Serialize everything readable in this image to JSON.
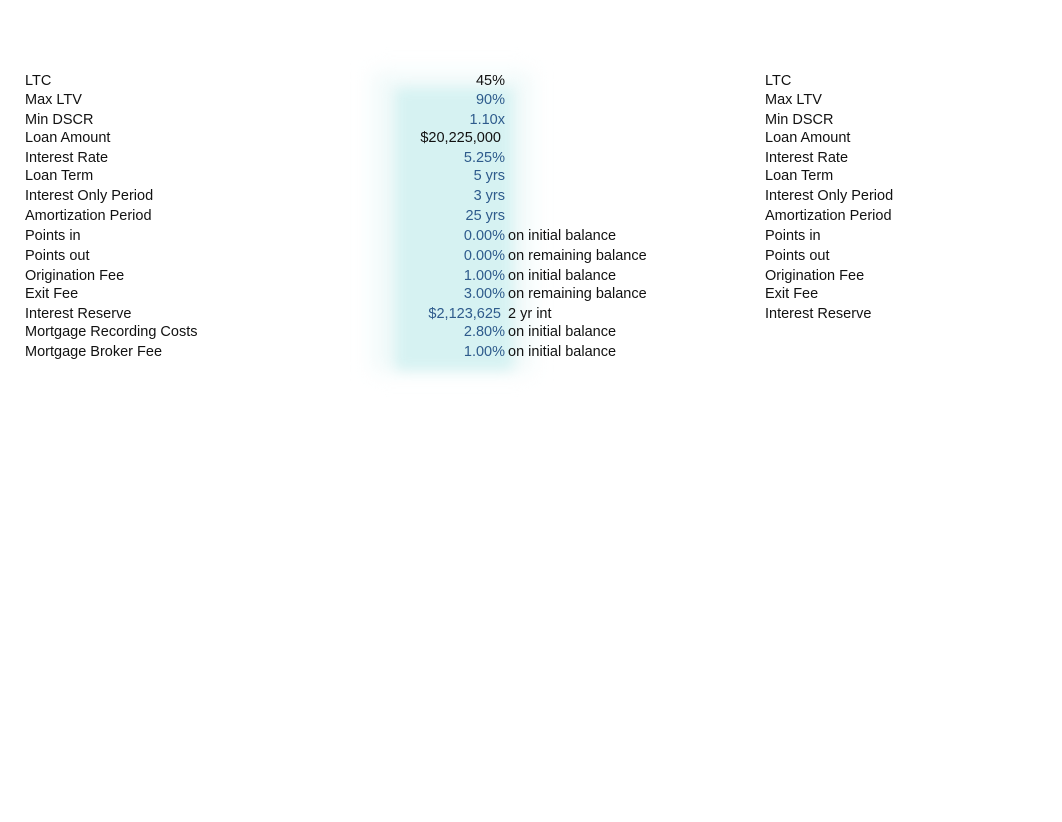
{
  "left_table": {
    "rows": [
      {
        "label": "LTC",
        "value": "45%",
        "value_style": "black",
        "note": ""
      },
      {
        "label": "Max LTV",
        "value": "90%",
        "value_style": "blue",
        "note": ""
      },
      {
        "label": "Min DSCR",
        "value": "1.10x",
        "value_style": "blue",
        "note": ""
      },
      {
        "label": "Loan Amount",
        "value": "$20,225,000",
        "value_style": "black",
        "note": ""
      },
      {
        "label": "Interest Rate",
        "value": "5.25%",
        "value_style": "blue",
        "note": ""
      },
      {
        "label": "Loan Term",
        "value": "5 yrs",
        "value_style": "blue",
        "note": ""
      },
      {
        "label": "Interest Only Period",
        "value": "3 yrs",
        "value_style": "blue",
        "note": ""
      },
      {
        "label": "Amortization Period",
        "value": "25 yrs",
        "value_style": "blue",
        "note": ""
      },
      {
        "label": "Points in",
        "value": "0.00%",
        "value_style": "blue",
        "note": "on initial balance"
      },
      {
        "label": "Points out",
        "value": "0.00%",
        "value_style": "blue",
        "note": "on remaining balance"
      },
      {
        "label": "Origination Fee",
        "value": "1.00%",
        "value_style": "blue",
        "note": "on initial balance"
      },
      {
        "label": "Exit Fee",
        "value": "3.00%",
        "value_style": "blue",
        "note": "on remaining balance"
      },
      {
        "label": "Interest Reserve",
        "value": "$2,123,625",
        "value_style": "blue",
        "note": "2 yr int"
      },
      {
        "label": "Mortgage Recording Costs",
        "value": "2.80%",
        "value_style": "blue",
        "note": "on initial balance"
      },
      {
        "label": "Mortgage Broker Fee",
        "value": "1.00%",
        "value_style": "blue",
        "note": "on initial balance"
      }
    ]
  },
  "right_table": {
    "labels": [
      "LTC",
      "Max LTV",
      "Min DSCR",
      "Loan Amount",
      "Interest Rate",
      "Loan Term",
      "Interest Only Period",
      "Amortization Period",
      "Points in",
      "Points out",
      "Origination Fee",
      "Exit Fee",
      "Interest Reserve"
    ]
  },
  "colors": {
    "input_blue": "#2e5b8c",
    "highlight": "#d6f2f2"
  }
}
